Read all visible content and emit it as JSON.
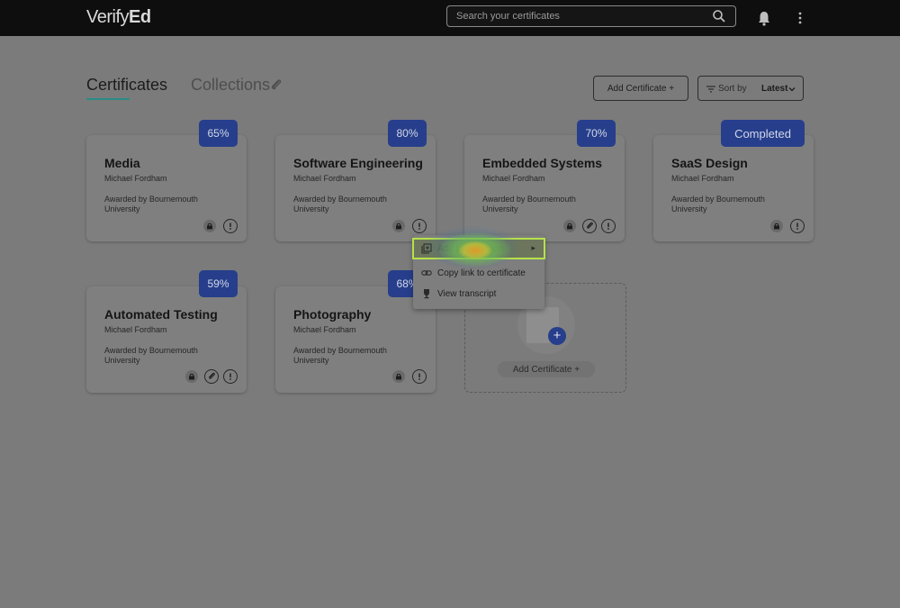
{
  "app": {
    "logo_light": "Verify",
    "logo_bold": "Ed",
    "search_placeholder": "Search your certificates"
  },
  "tabs": {
    "certificates": "Certificates",
    "collections": "Collections"
  },
  "toolbar": {
    "add_label": "Add Certificate +",
    "sort_label": "Sort by",
    "sort_value": "Latest"
  },
  "cards": [
    {
      "title": "Media",
      "owner": "Michael Fordham",
      "awarded": "Awarded by Bournemouth University",
      "badge": "65%"
    },
    {
      "title": "Software Engineering",
      "owner": "Michael Fordham",
      "awarded": "Awarded by Bournemouth University",
      "badge": "80%"
    },
    {
      "title": "Embedded Systems",
      "owner": "Michael Fordham",
      "awarded": "Awarded by Bournemouth University",
      "badge": "70%"
    },
    {
      "title": "SaaS Design",
      "owner": "Michael Fordham",
      "awarded": "Awarded by Bournemouth University",
      "badge": "Completed"
    },
    {
      "title": "Automated Testing",
      "owner": "Michael Fordham",
      "awarded": "Awarded by Bournemouth University",
      "badge": "59%"
    },
    {
      "title": "Photography",
      "owner": "Michael Fordham",
      "awarded": "Awarded by Bournemouth University",
      "badge": "68%"
    }
  ],
  "add_card": {
    "label": "Add Certificate +"
  },
  "context_menu": {
    "items": [
      {
        "label": "Add to collection",
        "icon": "library-add-icon"
      },
      {
        "label": "Copy link to certificate",
        "icon": "link-icon"
      },
      {
        "label": "View transcript",
        "icon": "trophy-icon"
      }
    ]
  },
  "colors": {
    "badge": "#263e8b",
    "tab_underline": "#2a8c86",
    "highlight_outline": "#b5e24b"
  }
}
